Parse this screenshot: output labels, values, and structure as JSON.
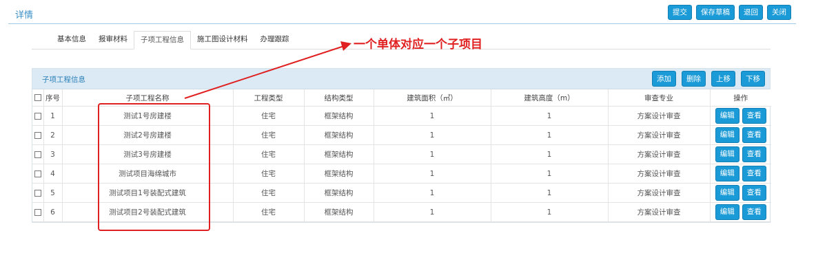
{
  "header": {
    "title": "详情",
    "actions": [
      "提交",
      "保存草稿",
      "退回",
      "关闭"
    ]
  },
  "tabs": [
    "基本信息",
    "报审材料",
    "子项工程信息",
    "施工图设计材料",
    "办理跟踪"
  ],
  "active_tab": "子项工程信息",
  "annotation": "一个单体对应一个子项目",
  "panel": {
    "title": "子项工程信息",
    "actions": [
      "添加",
      "删除",
      "上移",
      "下移"
    ]
  },
  "table": {
    "columns": [
      "序号",
      "子项工程名称",
      "工程类型",
      "结构类型",
      "建筑面积（㎡）",
      "建筑高度（m）",
      "审查专业",
      "操作"
    ],
    "rows": [
      {
        "no": "1",
        "name": "测试1号房建楼",
        "type": "住宅",
        "structure": "框架结构",
        "area": "1",
        "height": "1",
        "review": "方案设计审查"
      },
      {
        "no": "2",
        "name": "测试2号房建楼",
        "type": "住宅",
        "structure": "框架结构",
        "area": "1",
        "height": "1",
        "review": "方案设计审查"
      },
      {
        "no": "3",
        "name": "测试3号房建楼",
        "type": "住宅",
        "structure": "框架结构",
        "area": "1",
        "height": "1",
        "review": "方案设计审查"
      },
      {
        "no": "4",
        "name": "测试项目海绵城市",
        "type": "住宅",
        "structure": "框架结构",
        "area": "1",
        "height": "1",
        "review": "方案设计审查"
      },
      {
        "no": "5",
        "name": "测试项目1号装配式建筑",
        "type": "住宅",
        "structure": "框架结构",
        "area": "1",
        "height": "1",
        "review": "方案设计审查"
      },
      {
        "no": "6",
        "name": "测试项目2号装配式建筑",
        "type": "住宅",
        "structure": "框架结构",
        "area": "1",
        "height": "1",
        "review": "方案设计审查"
      }
    ],
    "row_actions": {
      "edit": "编辑",
      "view": "查看"
    }
  },
  "colors": {
    "accent": "#1a9ad6",
    "annotation": "#e02020",
    "panel_header": "#dbeaf5"
  }
}
